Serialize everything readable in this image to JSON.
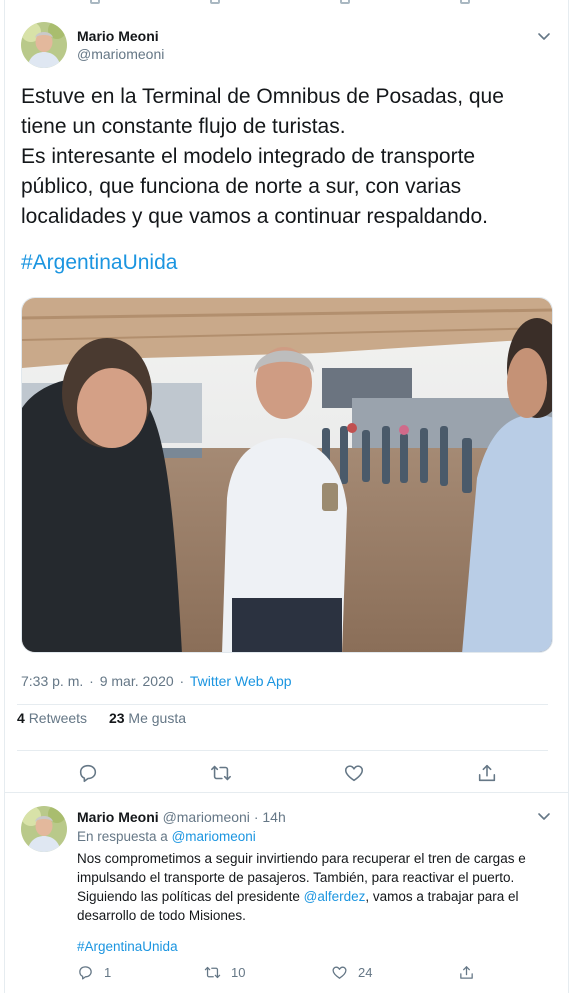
{
  "main_tweet": {
    "author_name": "Mario Meoni",
    "author_handle": "@mariomeoni",
    "text": "Estuve en la Terminal de Omnibus de Posadas, que\ntiene un constante flujo de turistas.\nEs interesante el modelo integrado de transporte\npúblico, que funciona de norte a sur, con varias\nlocalidades y que vamos a continuar respaldando.",
    "hashtag": "#ArgentinaUnida",
    "time": "7:33 p. m.",
    "date": "9 mar. 2020",
    "dot": "·",
    "app": "Twitter Web App",
    "retweets_count": "4",
    "retweets_label": "Retweets",
    "likes_count": "23",
    "likes_label": "Me gusta"
  },
  "reply_tweet": {
    "author_name": "Mario Meoni",
    "author_handle": "@mariomeoni",
    "dot": "·",
    "age": "14h",
    "reply_prefix": "En respuesta a",
    "reply_to": "@mariomeoni",
    "text_part1": "Nos comprometimos a seguir invirtiendo para recuperar el tren de cargas e impulsando el transporte de pasajeros. También, para reactivar el puerto. Siguiendo las políticas del presidente",
    "mention": "@alferdez",
    "text_part2": ", vamos a trabajar para el desarrollo de todo Misiones.",
    "hashtag": "#ArgentinaUnida",
    "replies": "1",
    "retweets": "10",
    "likes": "24"
  },
  "colors": {
    "link": "#1b95e0",
    "text": "#14171a",
    "muted": "#657786",
    "divider": "#e6ecf0"
  },
  "icons": [
    "chevron-down-icon",
    "reply-icon",
    "retweet-icon",
    "like-icon",
    "share-icon"
  ]
}
